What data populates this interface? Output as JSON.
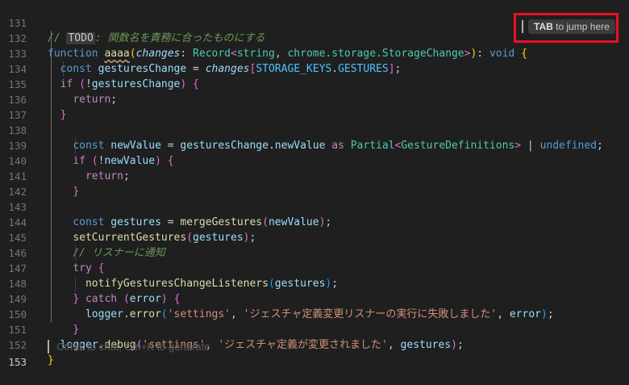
{
  "line_numbers": [
    "131",
    "132",
    "133",
    "134",
    "135",
    "136",
    "137",
    "138",
    "139",
    "140",
    "141",
    "142",
    "143",
    "144",
    "145",
    "146",
    "147",
    "148",
    "149",
    "150",
    "151",
    "152",
    "153"
  ],
  "tab_hint": {
    "key": "TAB",
    "text": "to jump here"
  },
  "chat_placeholder": "Ctrl+L to chat, Ctrl+K to generate",
  "code": {
    "l131": {
      "comment_prefix": "// ",
      "todo": "TODO",
      "comment_text": ": 関数名を責務に合ったものにする"
    },
    "l132": {
      "kw": "function",
      "name": "aaaa",
      "param": "changes",
      "type": "Record",
      "t1": "string",
      "t2": "chrome.storage.StorageChange",
      "ret": "void"
    },
    "l133": {
      "kw": "const",
      "var": "gesturesChange",
      "src": "changes",
      "key1": "STORAGE_KEYS",
      "key2": "GESTURES"
    },
    "l134": {
      "kw": "if",
      "not": "!",
      "var": "gesturesChange"
    },
    "l135": {
      "kw": "return"
    },
    "l138": {
      "kw": "const",
      "var": "newValue",
      "src": "gesturesChange",
      "prop": "newValue",
      "as": "as",
      "type": "Partial",
      "inner": "GestureDefinitions",
      "undef": "undefined"
    },
    "l139": {
      "kw": "if",
      "not": "!",
      "var": "newValue"
    },
    "l140": {
      "kw": "return"
    },
    "l143": {
      "kw": "const",
      "var": "gestures",
      "fn": "mergeGestures",
      "arg": "newValue"
    },
    "l144": {
      "fn": "setCurrentGestures",
      "arg": "gestures"
    },
    "l145": {
      "comment": "// リスナーに通知"
    },
    "l146": {
      "kw": "try"
    },
    "l147": {
      "fn": "notifyGesturesChangeListeners",
      "arg": "gestures"
    },
    "l148": {
      "kw": "catch",
      "arg": "error"
    },
    "l149": {
      "obj": "logger",
      "fn": "error",
      "s1": "'settings'",
      "s2": "'ジェスチャ定義変更リスナーの実行に失敗しました'",
      "arg": "error"
    },
    "l151": {
      "obj": "logger",
      "fn": "debug",
      "s1": "'settings'",
      "s2": "'ジェスチャ定義が変更されました'",
      "arg": "gestures"
    }
  }
}
